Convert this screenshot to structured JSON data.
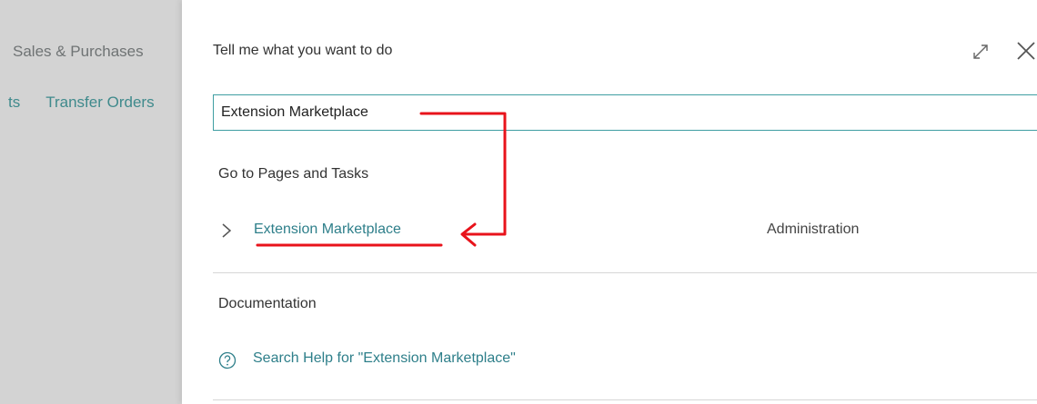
{
  "background": {
    "nav_row_1": "Sales & Purchases",
    "nav_row_2_left": "ts",
    "nav_row_2_right": "Transfer Orders"
  },
  "dialog": {
    "title": "Tell me what you want to do",
    "expand_icon": "expand-icon",
    "close_icon": "close-icon",
    "search": {
      "value": "Extension Marketplace"
    },
    "pages_section": {
      "heading": "Go to Pages and Tasks",
      "results": [
        {
          "label": "Extension Marketplace",
          "category": "Administration",
          "icon": "chevron-right-icon"
        }
      ]
    },
    "documentation_section": {
      "heading": "Documentation",
      "help_link": "Search Help for \"Extension Marketplace\"",
      "help_icon": "help-circle-icon"
    }
  },
  "colors": {
    "accent_teal": "#2e7f8a",
    "input_border": "#3f9ea2",
    "annotation_red": "#e8131b",
    "background_dim": "#d3d3d3"
  }
}
